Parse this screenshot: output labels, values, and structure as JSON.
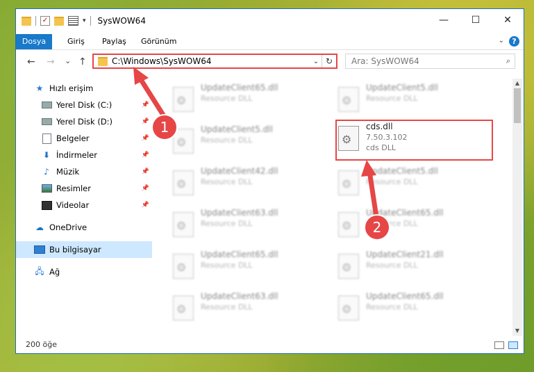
{
  "window": {
    "title": "SysWOW64",
    "controls": {
      "minimize": "—",
      "maximize": "☐",
      "close": "✕"
    }
  },
  "ribbon": {
    "tabs": [
      "Dosya",
      "Giriş",
      "Paylaş",
      "Görünüm"
    ],
    "help": "?"
  },
  "nav": {
    "back": "←",
    "forward": "→",
    "recent": "⌄",
    "up": "↑",
    "address": "C:\\Windows\\SysWOW64",
    "search_placeholder": "Ara: SysWOW64"
  },
  "sidebar": {
    "items": [
      {
        "label": "Hızlı erişim",
        "icon": "star-icon"
      },
      {
        "label": "Yerel Disk (C:)",
        "icon": "drive-icon",
        "pinned": true
      },
      {
        "label": "Yerel Disk (D:)",
        "icon": "drive-icon",
        "pinned": true
      },
      {
        "label": "Belgeler",
        "icon": "document-icon",
        "pinned": true
      },
      {
        "label": "İndirmeler",
        "icon": "download-icon",
        "pinned": true
      },
      {
        "label": "Müzik",
        "icon": "music-icon",
        "pinned": true
      },
      {
        "label": "Resimler",
        "icon": "pictures-icon",
        "pinned": true
      },
      {
        "label": "Videolar",
        "icon": "video-icon",
        "pinned": true
      },
      {
        "label": "OneDrive",
        "icon": "cloud-icon"
      },
      {
        "label": "Bu bilgisayar",
        "icon": "computer-icon",
        "selected": true
      },
      {
        "label": "Ağ",
        "icon": "network-icon"
      }
    ]
  },
  "files": [
    {
      "name": "UpdateClient65.dll",
      "sub": "Resource DLL"
    },
    {
      "name": "UpdateClient5.dll",
      "sub": "Resource DLL"
    },
    {
      "name": "UpdateClient5.dll",
      "sub": "Resource DLL"
    },
    {
      "name": "cds.dll",
      "sub": "7.50.3.102",
      "sub2": "cds DLL"
    },
    {
      "name": "UpdateClient42.dll",
      "sub": "Resource DLL"
    },
    {
      "name": "UpdateClient5.dll",
      "sub": "Resource DLL"
    },
    {
      "name": "UpdateClient63.dll",
      "sub": "Resource DLL"
    },
    {
      "name": "UpdateClient65.dll",
      "sub": "Resource DLL"
    },
    {
      "name": "UpdateClient65.dll",
      "sub": "Resource DLL"
    },
    {
      "name": "UpdateClient21.dll",
      "sub": "Resource DLL"
    },
    {
      "name": "UpdateClient63.dll",
      "sub": "Resource DLL"
    },
    {
      "name": "UpdateClient65.dll",
      "sub": "Resource DLL"
    }
  ],
  "status": {
    "count": "200 öğe"
  },
  "annotations": {
    "step1": "1",
    "step2": "2",
    "color": "#e64646"
  }
}
